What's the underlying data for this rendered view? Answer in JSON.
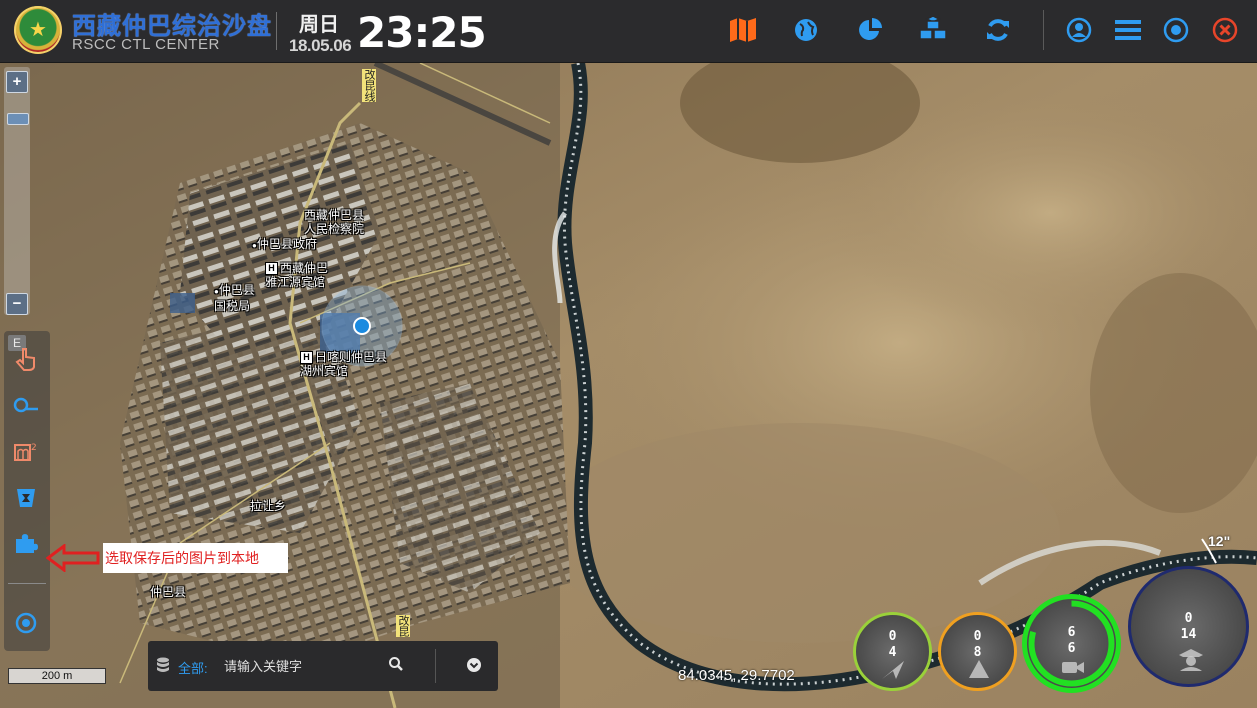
{
  "header": {
    "title_cn": "西藏仲巴综治沙盘",
    "title_en": "RSCC CTL CENTER",
    "weekday": "周日",
    "date": "18.05.06",
    "time": "23:25",
    "icons": [
      "map-icon",
      "globe-icon",
      "pie-chart-icon",
      "cubes-icon",
      "refresh-icon",
      "user-icon",
      "menu-icon",
      "target-icon",
      "close-icon"
    ],
    "accent_orange": "#ff6a1a",
    "accent_blue": "#2f9cf0",
    "close_red": "#e8452a"
  },
  "map": {
    "labels": {
      "road_top": "改昆线",
      "road_bottom": "改昆",
      "procuratorate": "西藏仲巴县人民检察院",
      "county_gov": "仲巴县政府",
      "hotel1": "西藏仲巴雅江源宾馆",
      "tax_bureau": "仲巴县国税局",
      "hotel2": "日喀则仲巴县湖州宾馆",
      "street": "拉让乡",
      "county": "仲巴县"
    },
    "zoom_in": "+",
    "zoom_out": "−",
    "scale": "200 m",
    "coordinates": "84.0345, 29.7702",
    "angle": "12\""
  },
  "tools": {
    "tag": "E",
    "items": [
      "hand-pointer-icon",
      "measure-distance-icon",
      "measure-area-icon",
      "trash-icon",
      "puzzle-icon",
      "locate-icon"
    ]
  },
  "annotation": {
    "text": "选取保存后的图片到本地"
  },
  "search": {
    "category": "全部:",
    "placeholder": "请输入关键字"
  },
  "gauges": [
    {
      "name": "gauge-arrow",
      "top": "0",
      "bottom": "4",
      "ring": "#9ad13a"
    },
    {
      "name": "gauge-warning",
      "top": "0",
      "bottom": "8",
      "ring": "#f0a020"
    },
    {
      "name": "gauge-camera",
      "top": "6",
      "bottom": "6",
      "ring": "#22e022"
    },
    {
      "name": "gauge-police",
      "top": "0",
      "bottom": "14",
      "ring": "#1f2a6e"
    }
  ]
}
